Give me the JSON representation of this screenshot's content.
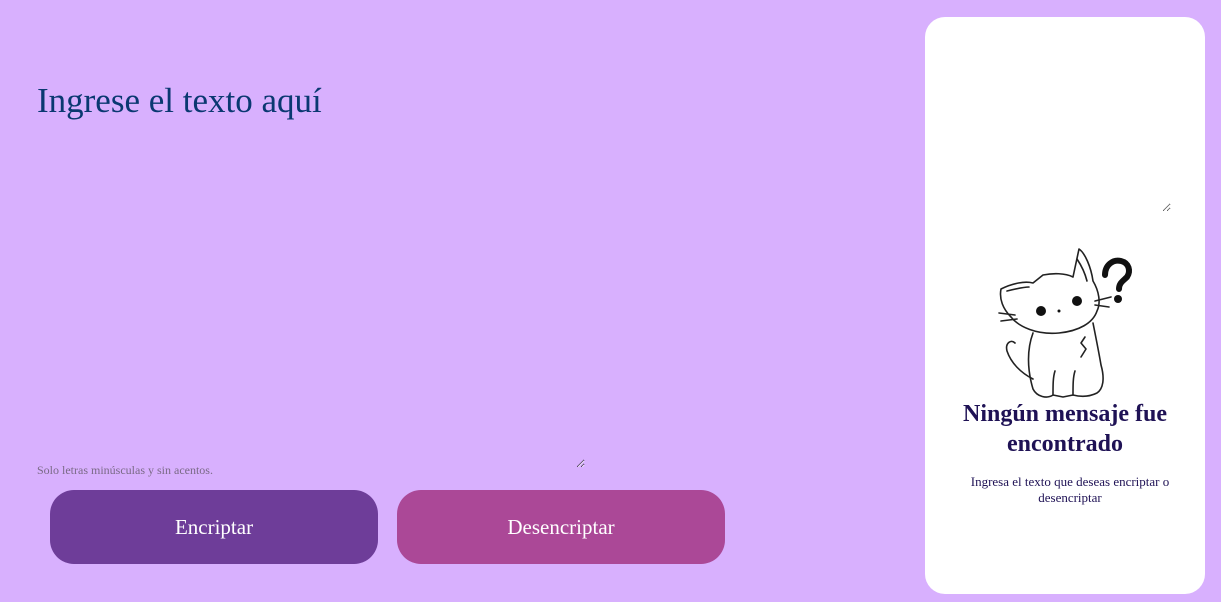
{
  "input": {
    "placeholder": "Ingrese el texto aquí",
    "value": ""
  },
  "hint": "Solo letras minúsculas y sin acentos.",
  "buttons": {
    "encrypt_label": "Encriptar",
    "decrypt_label": "Desencriptar"
  },
  "result": {
    "output_value": "",
    "empty_title": "Ningún mensaje fue encontrado",
    "empty_subtitle": "Ingresa el texto que deseas encriptar o desencriptar",
    "illustration": "confused-cat-icon"
  },
  "colors": {
    "background": "#d8b0fe",
    "encrypt_button": "#6e3d99",
    "decrypt_button": "#ab4897",
    "card": "#ffffff",
    "title_text": "#0a3871"
  }
}
